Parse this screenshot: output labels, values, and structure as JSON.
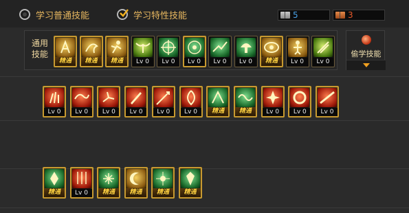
{
  "tabs": [
    {
      "label": "学习普通技能",
      "selected": false,
      "icon": "radio-icon"
    },
    {
      "label": "学习特性技能",
      "selected": true,
      "icon": "check-icon"
    }
  ],
  "points": [
    {
      "icon": "book-icon",
      "value": "5",
      "color": "#4aa3e8"
    },
    {
      "icon": "book-icon",
      "value": "3",
      "color": "#e85a2a"
    }
  ],
  "common_section": {
    "label_line1": "通用",
    "label_line2": "技能",
    "skills": [
      {
        "icon": "rune-figure-icon",
        "status": "精通",
        "color": "gold-yellow",
        "gold": true
      },
      {
        "icon": "dragon-claw-icon",
        "status": "精通",
        "color": "gold-yellow",
        "gold": true
      },
      {
        "icon": "sprint-icon",
        "status": "精通",
        "color": "gold-yellow",
        "gold": true
      },
      {
        "icon": "wings-icon",
        "status": "Lv 0",
        "color": "yg",
        "gold": false
      },
      {
        "icon": "target-icon",
        "status": "Lv 0",
        "color": "green",
        "gold": false
      },
      {
        "icon": "target-gear-icon",
        "status": "Lv 0",
        "color": "green",
        "gold": true
      },
      {
        "icon": "rush-icon",
        "status": "Lv 0",
        "color": "green",
        "gold": false
      },
      {
        "icon": "mushroom-icon",
        "status": "Lv 0",
        "color": "green",
        "gold": false
      },
      {
        "icon": "eye-icon",
        "status": "精通",
        "color": "gold-yellow",
        "gold": true
      },
      {
        "icon": "golden-figure-icon",
        "status": "Lv 0",
        "color": "gold-yellow",
        "gold": false
      },
      {
        "icon": "slash-icon",
        "status": "Lv 0",
        "color": "yg",
        "gold": false
      }
    ]
  },
  "steal": {
    "label": "偷学技能",
    "icon": "orb-icon"
  },
  "row2": [
    {
      "icon": "claw-icon",
      "status": "Lv 0",
      "color": "red"
    },
    {
      "icon": "dragon-icon",
      "status": "Lv 0",
      "color": "red"
    },
    {
      "icon": "kick-icon",
      "status": "Lv 0",
      "color": "red"
    },
    {
      "icon": "blade-icon",
      "status": "Lv 0",
      "color": "red"
    },
    {
      "icon": "spear-icon",
      "status": "Lv 0",
      "color": "red"
    },
    {
      "icon": "spin-blade-icon",
      "status": "Lv 0",
      "color": "red"
    },
    {
      "icon": "green-strike-icon",
      "status": "精通",
      "color": "green"
    },
    {
      "icon": "green-wave-icon",
      "status": "精通",
      "color": "green"
    },
    {
      "icon": "flame-burst-icon",
      "status": "Lv 0",
      "color": "red"
    },
    {
      "icon": "ring-icon",
      "status": "Lv 0",
      "color": "red"
    },
    {
      "icon": "thrust-icon",
      "status": "Lv 0",
      "color": "red"
    }
  ],
  "row3": [
    {
      "icon": "crystal-icon",
      "status": "精通",
      "color": "green"
    },
    {
      "icon": "arrow-rain-icon",
      "status": "Lv 0",
      "color": "red"
    },
    {
      "icon": "sparkle-icon",
      "status": "精通",
      "color": "green"
    },
    {
      "icon": "moon-icon",
      "status": "精通",
      "color": "gold-yellow"
    },
    {
      "icon": "star-burst-icon",
      "status": "精通",
      "color": "green"
    },
    {
      "icon": "gem-icon",
      "status": "精通",
      "color": "green"
    }
  ]
}
